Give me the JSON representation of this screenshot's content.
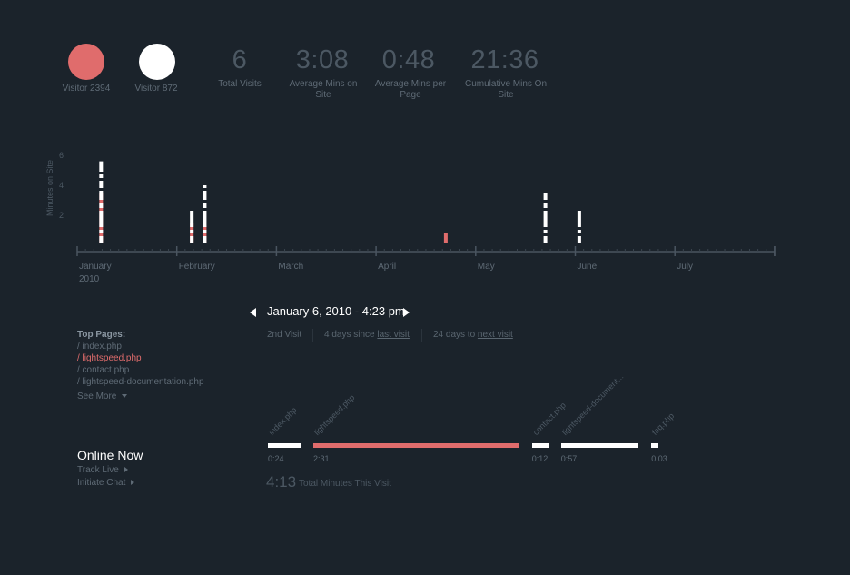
{
  "colors": {
    "background": "#1b232b",
    "accent": "#e06c6c",
    "white": "#ffffff",
    "muted": "#5f6b76",
    "axis": "#4a5560"
  },
  "visitors": [
    {
      "label": "Visitor 2394",
      "color": "#e06c6c"
    },
    {
      "label": "Visitor 872",
      "color": "#ffffff"
    }
  ],
  "stats": [
    {
      "value": "6",
      "label": "Total Visits"
    },
    {
      "value": "3:08",
      "label": "Average Mins on Site"
    },
    {
      "value": "0:48",
      "label": "Average Mins per Page"
    },
    {
      "value": "21:36",
      "label": "Cumulative Mins On Site"
    }
  ],
  "chart_data": {
    "type": "bar",
    "ylabel": "Minutes on Site",
    "yticks": [
      "2",
      "4",
      "6"
    ],
    "ylim": [
      0,
      6
    ],
    "xlabels": [
      "January",
      "February",
      "March",
      "April",
      "May",
      "June",
      "July"
    ],
    "xsublabel": "2010",
    "series": [
      {
        "name": "Visitor 2394",
        "color": "#e06c6c",
        "bars": [
          {
            "month": 0.24,
            "value": 3.5
          },
          {
            "month": 1.15,
            "value": 1.5
          },
          {
            "month": 1.28,
            "value": 1.3
          },
          {
            "month": 3.7,
            "value": 0.8
          }
        ]
      },
      {
        "name": "Visitor 872",
        "color": "#ffffff",
        "bars": [
          {
            "month": 0.24,
            "value": 5.6,
            "dashed": true
          },
          {
            "month": 1.15,
            "value": 2.4,
            "dashed": true
          },
          {
            "month": 1.28,
            "value": 4.0,
            "dashed": true
          },
          {
            "month": 4.7,
            "value": 3.5,
            "dashed": true
          },
          {
            "month": 5.04,
            "value": 2.4,
            "dashed": true
          }
        ]
      }
    ]
  },
  "visit_nav": {
    "title": "January 6, 2010 - 4:23 pm",
    "visit_number": "2nd Visit",
    "since_prefix": "4 days since ",
    "since_link": "last visit",
    "until_prefix": "24 days to ",
    "until_link": "next visit"
  },
  "top_pages": {
    "heading": "Top Pages:",
    "items": [
      {
        "label": "/ index.php",
        "active": false
      },
      {
        "label": "/ lightspeed.php",
        "active": true
      },
      {
        "label": "/ contact.php",
        "active": false
      },
      {
        "label": "/ lightspeed-documentation.php",
        "active": false
      }
    ],
    "see_more": "See More"
  },
  "online": {
    "title": "Online Now",
    "track_live": "Track Live",
    "initiate_chat": "Initiate Chat"
  },
  "timeline": {
    "segments": [
      {
        "page": "index.php",
        "duration": "0:24",
        "minutes": 0.4,
        "color": "#ffffff"
      },
      {
        "page": "lightspeed.php",
        "duration": "2:31",
        "minutes": 2.52,
        "color": "#e06c6c"
      },
      {
        "page": "contact.php",
        "duration": "0:12",
        "minutes": 0.2,
        "color": "#ffffff"
      },
      {
        "page": "lightspeed-document...",
        "duration": "0:57",
        "minutes": 0.95,
        "color": "#ffffff"
      },
      {
        "page": "faq.php",
        "duration": "0:03",
        "minutes": 0.05,
        "color": "#ffffff"
      }
    ],
    "total_value": "4:13",
    "total_label": "Total Minutes This Visit"
  }
}
